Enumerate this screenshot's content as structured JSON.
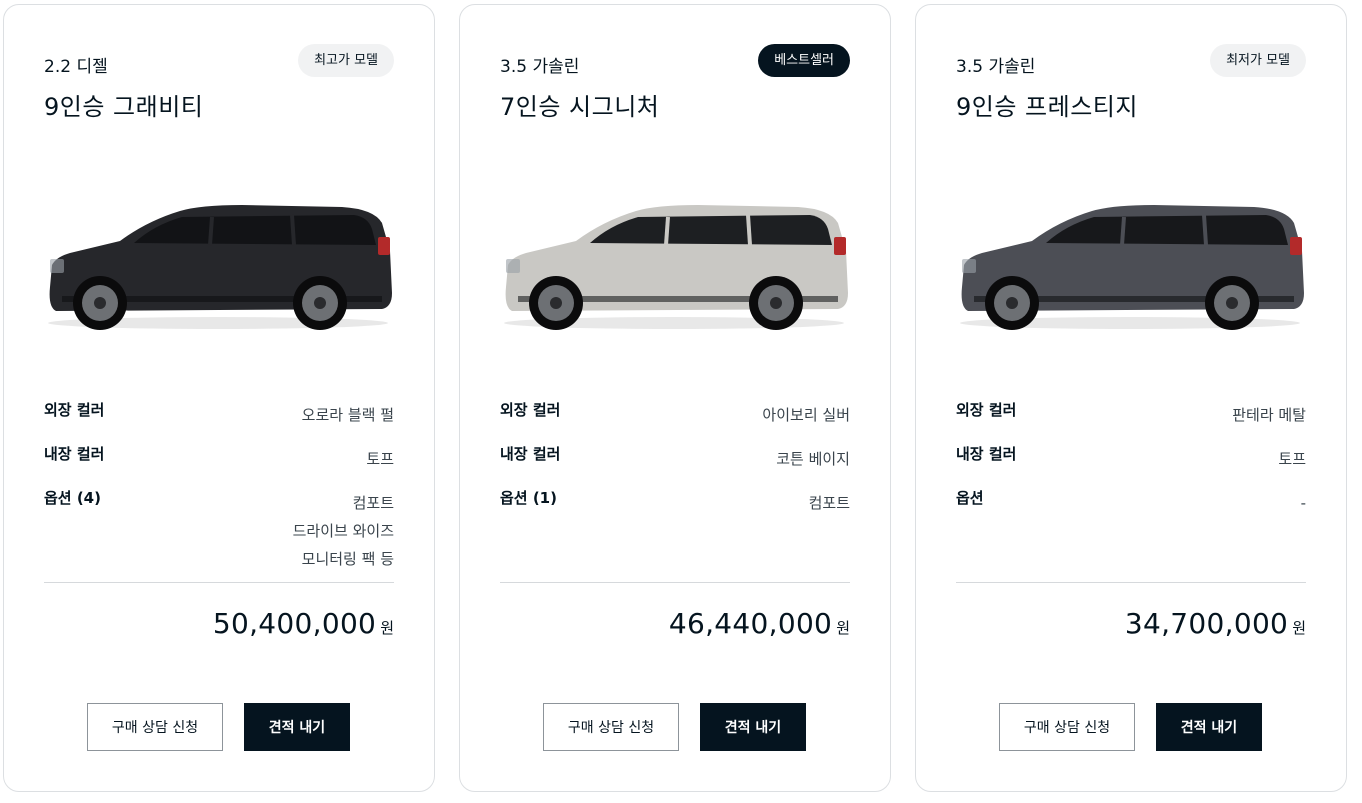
{
  "cards": [
    {
      "engine": "2.2 디젤",
      "trim": "9인승 그래비티",
      "badge": "최고가 모델",
      "car_body_color": "#26272b",
      "car_window_color": "#121316",
      "specs": [
        {
          "label": "외장 컬러",
          "values": [
            "오로라 블랙 펄"
          ]
        },
        {
          "label": "내장 컬러",
          "values": [
            "토프"
          ]
        },
        {
          "label": "옵션 (4)",
          "values": [
            "컴포트",
            "드라이브 와이즈",
            "모니터링 팩 등"
          ]
        }
      ],
      "price": "50,400,000",
      "price_unit": "원",
      "consult_button": "구매 상담 신청",
      "quote_button": "견적 내기"
    },
    {
      "engine": "3.5 가솔린",
      "trim": "7인승 시그니처",
      "badge": "베스트셀러",
      "car_body_color": "#c9c8c4",
      "car_window_color": "#1d1f22",
      "specs": [
        {
          "label": "외장 컬러",
          "values": [
            "아이보리 실버"
          ]
        },
        {
          "label": "내장 컬러",
          "values": [
            "코튼 베이지"
          ]
        },
        {
          "label": "옵션 (1)",
          "values": [
            "컴포트"
          ]
        }
      ],
      "price": "46,440,000",
      "price_unit": "원",
      "consult_button": "구매 상담 신청",
      "quote_button": "견적 내기"
    },
    {
      "engine": "3.5 가솔린",
      "trim": "9인승 프레스티지",
      "badge": "최저가 모델",
      "car_body_color": "#4c4e55",
      "car_window_color": "#17181b",
      "specs": [
        {
          "label": "외장 컬러",
          "values": [
            "판테라 메탈"
          ]
        },
        {
          "label": "내장 컬러",
          "values": [
            "토프"
          ]
        },
        {
          "label": "옵션",
          "values": [
            "-"
          ]
        }
      ],
      "price": "34,700,000",
      "price_unit": "원",
      "consult_button": "구매 상담 신청",
      "quote_button": "견적 내기"
    }
  ],
  "colors": {
    "primary": "#05141f",
    "border": "#dcdfe2",
    "badge_light_bg": "#f1f2f3"
  }
}
